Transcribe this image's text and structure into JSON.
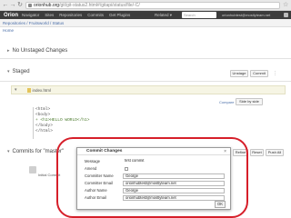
{
  "browser": {
    "url_host": "orionhub.org",
    "url_path": "/git/git-status2.html#/gitapi/status/file/-C/"
  },
  "banner": {
    "logo": "Orion",
    "links": [
      "Navigator",
      "Sites",
      "Repositories",
      "Commits",
      "Get Plugins"
    ],
    "related": "Related ▾",
    "search_placeholder": "Search",
    "user": "orionhubtest@mostlyteam.net"
  },
  "breadcrumb": "Repositories / Fruitsworld / Status",
  "page_title": "Home",
  "unstaged": {
    "title": "No Unstaged Changes"
  },
  "staged": {
    "title": "Staged",
    "unstage_button": "Unstage",
    "commit_button": "Commit",
    "file": "index.html",
    "compare_link": "Compare",
    "side_by_side_button": "Side by side",
    "diff_lines": [
      {
        "text": "<html>",
        "type": "ctx"
      },
      {
        "text": "  <body>",
        "type": "ctx"
      },
      {
        "text": "+    <h1>HELLO WORLD</h1>",
        "type": "add"
      },
      {
        "text": "  </body>",
        "type": "ctx"
      },
      {
        "text": "</html>",
        "type": "ctx"
      }
    ]
  },
  "commits": {
    "title": "Commits for \"master\"",
    "refine_button": "Refine",
    "reset_button": "Reset",
    "push_all_button": "Push All",
    "entry_text": "Initial Commit"
  },
  "dialog": {
    "title": "Commit Changes",
    "fields": [
      {
        "label": "Message",
        "value": "first commit"
      },
      {
        "label": "Amend",
        "value": ""
      },
      {
        "label": "Committer Name",
        "value": "George"
      },
      {
        "label": "Committer Email",
        "value": "orionhubtest@mostlyteam.net"
      },
      {
        "label": "Author Name",
        "value": "George"
      },
      {
        "label": "Author Email",
        "value": "orionhubtest@mostlyteam.net"
      }
    ],
    "ok_button": "OK"
  },
  "colors": {
    "highlight": "#d61f2a",
    "banner": "#3c3c3c",
    "link": "#4a6ea9",
    "staged_row": "#f6f5e4"
  }
}
